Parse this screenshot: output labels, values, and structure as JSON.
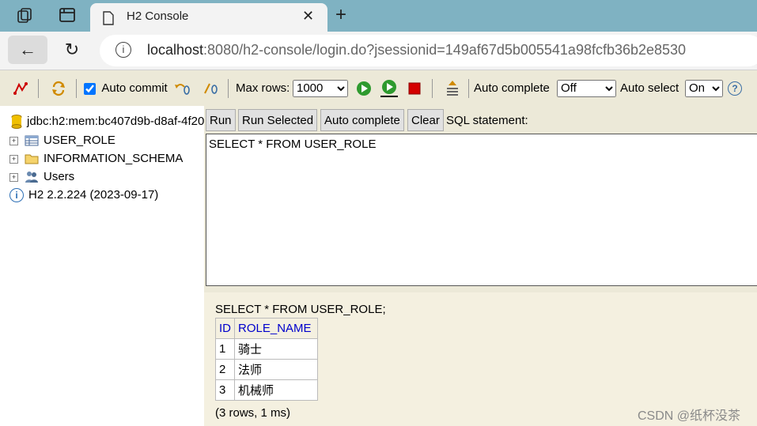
{
  "browser": {
    "tab_title": "H2 Console",
    "close_glyph": "✕",
    "new_tab_glyph": "+",
    "back_glyph": "←",
    "reload_glyph": "↻",
    "url_host": "localhost",
    "url_rest": ":8080/h2-console/login.do?jsessionid=149af67d5b005541a98fcfb36b2e8530"
  },
  "toolbar": {
    "auto_commit_label": "Auto commit",
    "auto_commit_checked": true,
    "max_rows_label": "Max rows:",
    "max_rows_value": "1000",
    "auto_complete_label": "Auto complete",
    "auto_complete_value": "Off",
    "auto_select_label": "Auto select",
    "auto_select_value": "On",
    "help_glyph": "?"
  },
  "tree": {
    "connection": "jdbc:h2:mem:bc407d9b-d8af-4f20",
    "items": [
      {
        "label": "USER_ROLE",
        "icon": "table-icon"
      },
      {
        "label": "INFORMATION_SCHEMA",
        "icon": "folder-icon"
      },
      {
        "label": "Users",
        "icon": "users-icon"
      }
    ],
    "version": "H2 2.2.224 (2023-09-17)"
  },
  "editor": {
    "run_label": "Run",
    "run_selected_label": "Run Selected",
    "auto_complete_label": "Auto complete",
    "clear_label": "Clear",
    "sql_statement_label": "SQL statement:",
    "sql_text": "SELECT * FROM USER_ROLE"
  },
  "result": {
    "statement": "SELECT * FROM USER_ROLE;",
    "columns": [
      "ID",
      "ROLE_NAME"
    ],
    "rows": [
      [
        "1",
        "骑士"
      ],
      [
        "2",
        "法师"
      ],
      [
        "3",
        "机械师"
      ]
    ],
    "info": "(3 rows, 1 ms)"
  },
  "watermark": "CSDN @纸杯没茶",
  "colors": {
    "tab_bar": "#7fb2c2",
    "toolbar_bg": "#ece9d8",
    "result_bg": "#f4f0e0",
    "header_link": "#0000cc"
  }
}
